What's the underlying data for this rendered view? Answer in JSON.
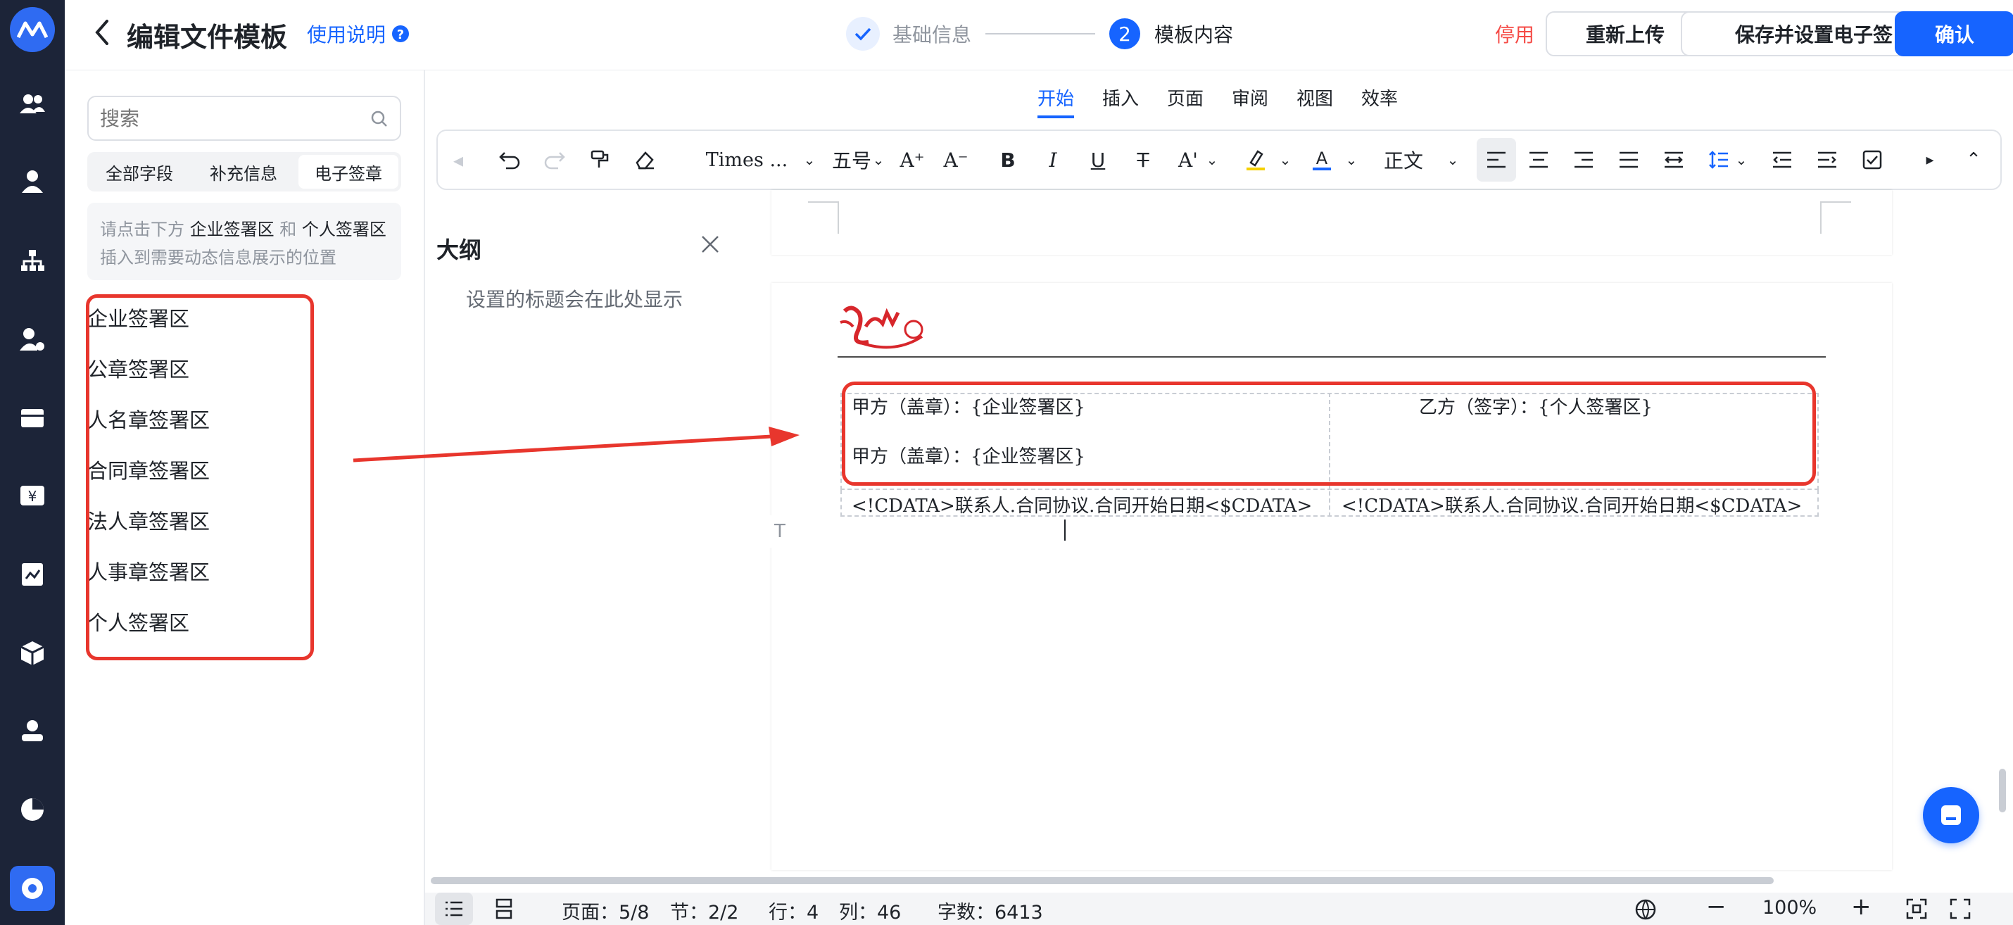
{
  "header": {
    "back_icon": "chevron-left-icon",
    "title": "编辑文件模板",
    "help_link": "使用说明",
    "help_icon": "question-circle-icon",
    "steps": [
      {
        "label": "基础信息",
        "state": "done"
      },
      {
        "number": "2",
        "label": "模板内容",
        "state": "active"
      }
    ],
    "disable_label": "停用",
    "reupload_label": "重新上传",
    "save_sign_label": "保存并设置电子签",
    "confirm_label": "确认",
    "accent": "#1664ff",
    "danger": "#f54a45"
  },
  "left": {
    "search_placeholder": "搜索",
    "tabs": [
      "全部字段",
      "补充信息",
      "电子签章"
    ],
    "active_tab": "电子签章",
    "hint": {
      "line1_pre": "请点击下方",
      "line1_a": "企业签署区",
      "line1_mid": "和",
      "line1_b": "个人签署区",
      "line2": "插入到需要动态信息展示的位置"
    },
    "sign_items": [
      "企业签署区",
      "公章签署区",
      "人名章签署区",
      "合同章签署区",
      "法人章签署区",
      "人事章签署区",
      "个人签署区"
    ]
  },
  "editor": {
    "menu_tabs": [
      "开始",
      "插入",
      "页面",
      "审阅",
      "视图",
      "效率"
    ],
    "active_menu": "开始",
    "font_name": "Times ...",
    "font_size": "五号",
    "paragraph_style": "正文",
    "outline_title": "大纲",
    "outline_empty": "设置的标题会在此处显示"
  },
  "document": {
    "table_row1_left_a": "甲方（盖章）：{企业签署区}",
    "table_row1_left_b": "甲方（盖章）：{企业签署区}",
    "table_row1_right": "乙方（签字）：{个人签署区}",
    "table_row2_left": "<!CDATA>联系人.合同协议.合同开始日期<$CDATA>",
    "table_row2_right": "<!CDATA>联系人.合同协议.合同开始日期<$CDATA>"
  },
  "status": {
    "page": "页面：5/8",
    "section": "节：2/2",
    "row": "行：4",
    "col": "列：46",
    "words": "字数：6413",
    "zoom": "100%"
  }
}
